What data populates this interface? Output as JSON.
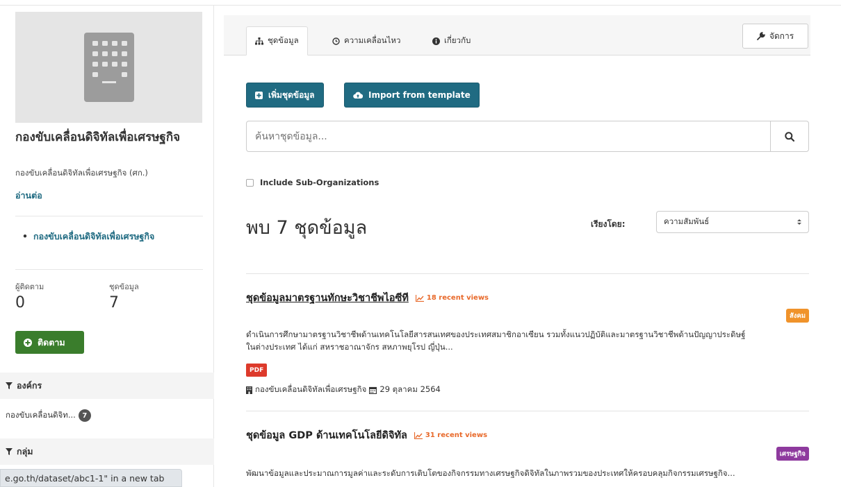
{
  "sidebar": {
    "org_name": "กองขับเคลื่อนดิจิทัลเพื่อเศรษฐกิจ",
    "org_desc": "กองขับเคลื่อนดิจิทัลเพื่อเศรษฐกิจ (ศก.)",
    "read_more": "อ่านต่อ",
    "tree_item": "กองขับเคลื่อนดิจิทัลเพื่อเศรษฐกิจ",
    "followers_label": "ผู้ติดตาม",
    "followers_value": "0",
    "datasets_label": "ชุดข้อมูล",
    "datasets_value": "7",
    "follow_label": "ติดตาม",
    "facet_org_title": "องค์กร",
    "facet_org_item": "กองขับเคลื่อนดิจิท...",
    "facet_org_count": "7",
    "facet_group_title": "กลุ่ม"
  },
  "status_bar": "e.go.th/dataset/abc1-1\" in a new tab",
  "tabs": [
    {
      "label": "ชุดข้อมูล",
      "icon": "sitemap-icon"
    },
    {
      "label": "ความเคลื่อนไหว",
      "icon": "clock-icon"
    },
    {
      "label": "เกี่ยวกับ",
      "icon": "info-icon"
    }
  ],
  "manage_label": "จัดการ",
  "add_dataset_label": "เพิ่มชุดข้อมูล",
  "import_label": "Import from template",
  "search": {
    "placeholder": "ค้นหาชุดข้อมูล..."
  },
  "include_sub_orgs": "Include Sub-Organizations",
  "found_text": "พบ 7 ชุดข้อมูล",
  "sort": {
    "label": "เรียงโดย:",
    "selected": "ความสัมพันธ์"
  },
  "datasets": [
    {
      "title": "ชุดข้อมูลมาตรฐานทักษะวิชาชีพไอซีที",
      "views": "18 recent views",
      "tag": "สังคม",
      "tag_color": "#f0932b",
      "notes_line1": "ดำเนินการศึกษามาตรฐานวิชาชีพด้านเทคโนโลยีสารสนเทศของประเทศสมาชิกอาเซียน รวมทั้งแนวปฏิบัติและมาตรฐานวิชาชีพด้านปัญญาประดิษฐ์",
      "notes_line2": "ในต่างประเทศ ได้แก่ สหราชอาณาจักร สหภาพยุโรป ญี่ปุ่น...",
      "format": "PDF",
      "org": "กองขับเคลื่อนดิจิทัลเพื่อเศรษฐกิจ",
      "date": "29 ตุลาคม 2564"
    },
    {
      "title": "ชุดข้อมูล GDP ด้านเทคโนโลยีดิจิทัล",
      "views": "31 recent views",
      "tag": "เศรษฐกิจ",
      "tag_color": "#8e3a9e",
      "notes_line1": "พัฒนาข้อมูลและประมาณการมูลค่าและระดับการเติบโตของกิจกรรมทางเศรษฐกิจดิจิทัลในภาพรวมของประเทศให้ครอบคลุมกิจกรรมเศรษฐกิจ..."
    }
  ],
  "colors": {
    "primary": "#206b82",
    "follow": "#3a7d2c",
    "views": "#e8692a",
    "pdf": "#dd3a2b"
  }
}
